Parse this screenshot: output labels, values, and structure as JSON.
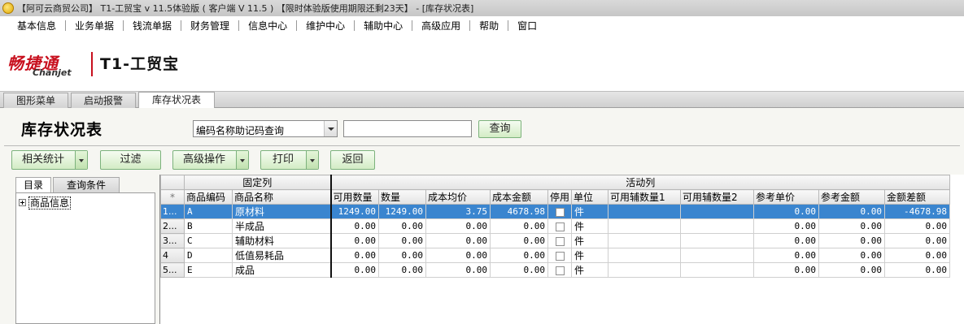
{
  "window": {
    "title": "【阿可云商贸公司】 T1-工贸宝 v 11.5体验版 ( 客户端 V 11.5 ) 【限时体验版使用期限还剩23天】 - [库存状况表]"
  },
  "menu": [
    "基本信息",
    "业务单据",
    "钱流单据",
    "财务管理",
    "信息中心",
    "维护中心",
    "辅助中心",
    "高级应用",
    "帮助",
    "窗口"
  ],
  "brand": {
    "cn": "畅捷通",
    "en": "Chanjet",
    "product": "T1-工贸宝"
  },
  "tabs": [
    "图形菜单",
    "启动报警",
    "库存状况表"
  ],
  "report": {
    "title": "库存状况表"
  },
  "search": {
    "mode": "编码名称助记码查询",
    "value": "",
    "query_label": "查询"
  },
  "toolbar": {
    "stats": "相关统计",
    "filter": "过滤",
    "advanced": "高级操作",
    "print": "打印",
    "back": "返回"
  },
  "side_tabs": [
    "目录",
    "查询条件"
  ],
  "tree": {
    "root": "商品信息"
  },
  "grid": {
    "groups": {
      "fixed": "固定列",
      "active": "活动列"
    },
    "corner": "*",
    "columns": [
      "商品编码",
      "商品名称",
      "可用数量",
      "数量",
      "成本均价",
      "成本金额",
      "停用",
      "单位",
      "可用辅数量1",
      "可用辅数量2",
      "参考单价",
      "参考金额",
      "金额差额"
    ],
    "rows": [
      {
        "no": "1...",
        "code": "A",
        "name": "原材料",
        "avail_qty": "1249.00",
        "qty": "1249.00",
        "avg_cost": "3.75",
        "cost_amount": "4678.98",
        "unit": "件",
        "aux1": "",
        "aux2": "",
        "ref_price": "0.00",
        "ref_amount": "0.00",
        "diff": "-4678.98"
      },
      {
        "no": "2...",
        "code": "B",
        "name": "半成品",
        "avail_qty": "0.00",
        "qty": "0.00",
        "avg_cost": "0.00",
        "cost_amount": "0.00",
        "unit": "件",
        "aux1": "",
        "aux2": "",
        "ref_price": "0.00",
        "ref_amount": "0.00",
        "diff": "0.00"
      },
      {
        "no": "3...",
        "code": "C",
        "name": "辅助材料",
        "avail_qty": "0.00",
        "qty": "0.00",
        "avg_cost": "0.00",
        "cost_amount": "0.00",
        "unit": "件",
        "aux1": "",
        "aux2": "",
        "ref_price": "0.00",
        "ref_amount": "0.00",
        "diff": "0.00"
      },
      {
        "no": "4",
        "code": "D",
        "name": "低值易耗品",
        "avail_qty": "0.00",
        "qty": "0.00",
        "avg_cost": "0.00",
        "cost_amount": "0.00",
        "unit": "件",
        "aux1": "",
        "aux2": "",
        "ref_price": "0.00",
        "ref_amount": "0.00",
        "diff": "0.00"
      },
      {
        "no": "5...",
        "code": "E",
        "name": "成品",
        "avail_qty": "0.00",
        "qty": "0.00",
        "avg_cost": "0.00",
        "cost_amount": "0.00",
        "unit": "件",
        "aux1": "",
        "aux2": "",
        "ref_price": "0.00",
        "ref_amount": "0.00",
        "diff": "0.00"
      }
    ],
    "selected_row": 0
  }
}
